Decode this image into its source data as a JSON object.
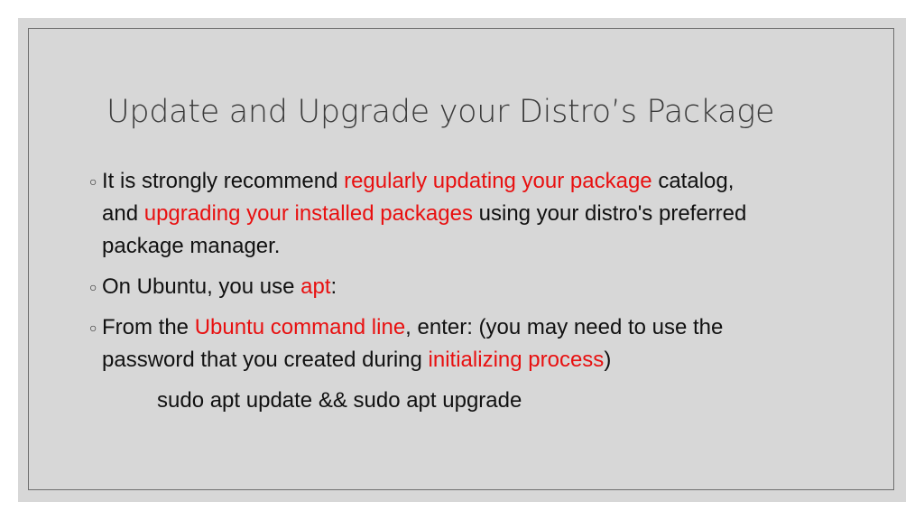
{
  "slide": {
    "title": "Update and Upgrade your Distro’s Package",
    "accent_color": "#e81010",
    "bullets": [
      {
        "segments": [
          {
            "text": "It is strongly recommend ",
            "highlight": false
          },
          {
            "text": "regularly updating your package",
            "highlight": true
          },
          {
            "text": " catalog,",
            "highlight": false
          },
          {
            "text": "and ",
            "highlight": false
          },
          {
            "text": "upgrading your installed packages",
            "highlight": true
          },
          {
            "text": " using your distro's preferred",
            "highlight": false
          },
          {
            "text": "package manager.",
            "highlight": false
          }
        ]
      },
      {
        "segments": [
          {
            "text": "On Ubuntu, you use ",
            "highlight": false
          },
          {
            "text": "apt",
            "highlight": true
          },
          {
            "text": ":",
            "highlight": false
          }
        ]
      },
      {
        "segments": [
          {
            "text": "From the ",
            "highlight": false
          },
          {
            "text": "Ubuntu command line",
            "highlight": true
          },
          {
            "text": ", enter: (you may need to use the",
            "highlight": false
          },
          {
            "text": "password that you created during ",
            "highlight": false
          },
          {
            "text": "initializing process",
            "highlight": true
          },
          {
            "text": ")",
            "highlight": false
          }
        ]
      }
    ],
    "bullet_icon": "hollow-circle-bullet",
    "command": "sudo apt update && sudo apt upgrade"
  }
}
